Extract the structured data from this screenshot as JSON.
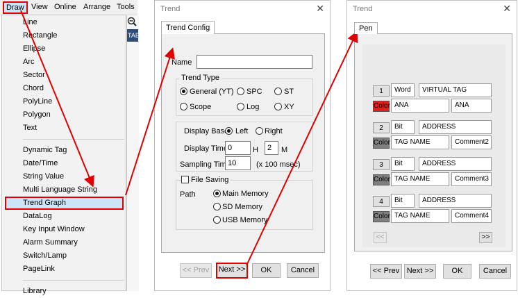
{
  "menu": {
    "bar_items": [
      "Draw",
      "View",
      "Online",
      "Arrange",
      "Tools"
    ],
    "dropdown_groups": [
      [
        "Line",
        "Rectangle",
        "Ellipse",
        "Arc",
        "Sector",
        "Chord",
        "PolyLine",
        "Polygon",
        "Text"
      ],
      [
        "Dynamic Tag",
        "Date/Time",
        "String Value",
        "Multi Language String",
        "Trend Graph",
        "DataLog",
        "Key Input Window",
        "Alarm Summary",
        "Switch/Lamp",
        "PageLink"
      ],
      [
        "Library"
      ]
    ],
    "highlighted_item": "Trend Graph",
    "background_tab_text": "TAB"
  },
  "trend_config": {
    "window_title": "Trend",
    "close_glyph": "✕",
    "tab_label": "Trend Config",
    "name_label": "Name",
    "name_value": "",
    "trend_type_label": "Trend Type",
    "trend_types": [
      {
        "label": "General (YT)",
        "checked": true
      },
      {
        "label": "SPC",
        "checked": false
      },
      {
        "label": "ST",
        "checked": false
      },
      {
        "label": "Scope",
        "checked": false
      },
      {
        "label": "Log",
        "checked": false
      },
      {
        "label": "XY",
        "checked": false
      }
    ],
    "display_base_label": "Display Base",
    "display_base_left": "Left",
    "display_base_right": "Right",
    "display_time_label": "Display Time",
    "display_time_h_value": "0",
    "display_time_h_unit": "H",
    "display_time_m_value": "2",
    "display_time_m_unit": "M",
    "sampling_time_label": "Sampling Time",
    "sampling_time_value": "10",
    "sampling_time_unit": "(x 100 msec)",
    "file_saving_label": "File Saving",
    "path_label": "Path",
    "paths": [
      {
        "label": "Main Memory",
        "checked": true
      },
      {
        "label": "SD Memory",
        "checked": false
      },
      {
        "label": "USB Memory",
        "checked": false
      }
    ],
    "buttons": {
      "prev": "<< Prev",
      "next": "Next >>",
      "ok": "OK",
      "cancel": "Cancel"
    }
  },
  "pen_dialog": {
    "window_title": "Trend",
    "close_glyph": "✕",
    "tab_label": "Pen",
    "pens": [
      {
        "number": "1",
        "type": "Word",
        "address": "VIRTUAL TAG",
        "color_label": "Color",
        "color": "#e02020",
        "tag": "ANA",
        "comment": "ANA"
      },
      {
        "number": "2",
        "type": "Bit",
        "address": "ADDRESS",
        "color_label": "Color",
        "color": "#7f7f7f",
        "tag": "TAG NAME",
        "comment": "Comment2"
      },
      {
        "number": "3",
        "type": "Bit",
        "address": "ADDRESS",
        "color_label": "Color",
        "color": "#7f7f7f",
        "tag": "TAG NAME",
        "comment": "Comment3"
      },
      {
        "number": "4",
        "type": "Bit",
        "address": "ADDRESS",
        "color_label": "Color",
        "color": "#7f7f7f",
        "tag": "TAG NAME",
        "comment": "Comment4"
      }
    ],
    "page_prev": "<<",
    "page_next": ">>",
    "buttons": {
      "prev": "<< Prev",
      "next": "Next >>",
      "ok": "OK",
      "cancel": "Cancel"
    }
  },
  "colors": {
    "highlight": "#e00000",
    "menu_highlight_bg": "#cce4f7",
    "dialog_bg": "#f0f0f0"
  }
}
